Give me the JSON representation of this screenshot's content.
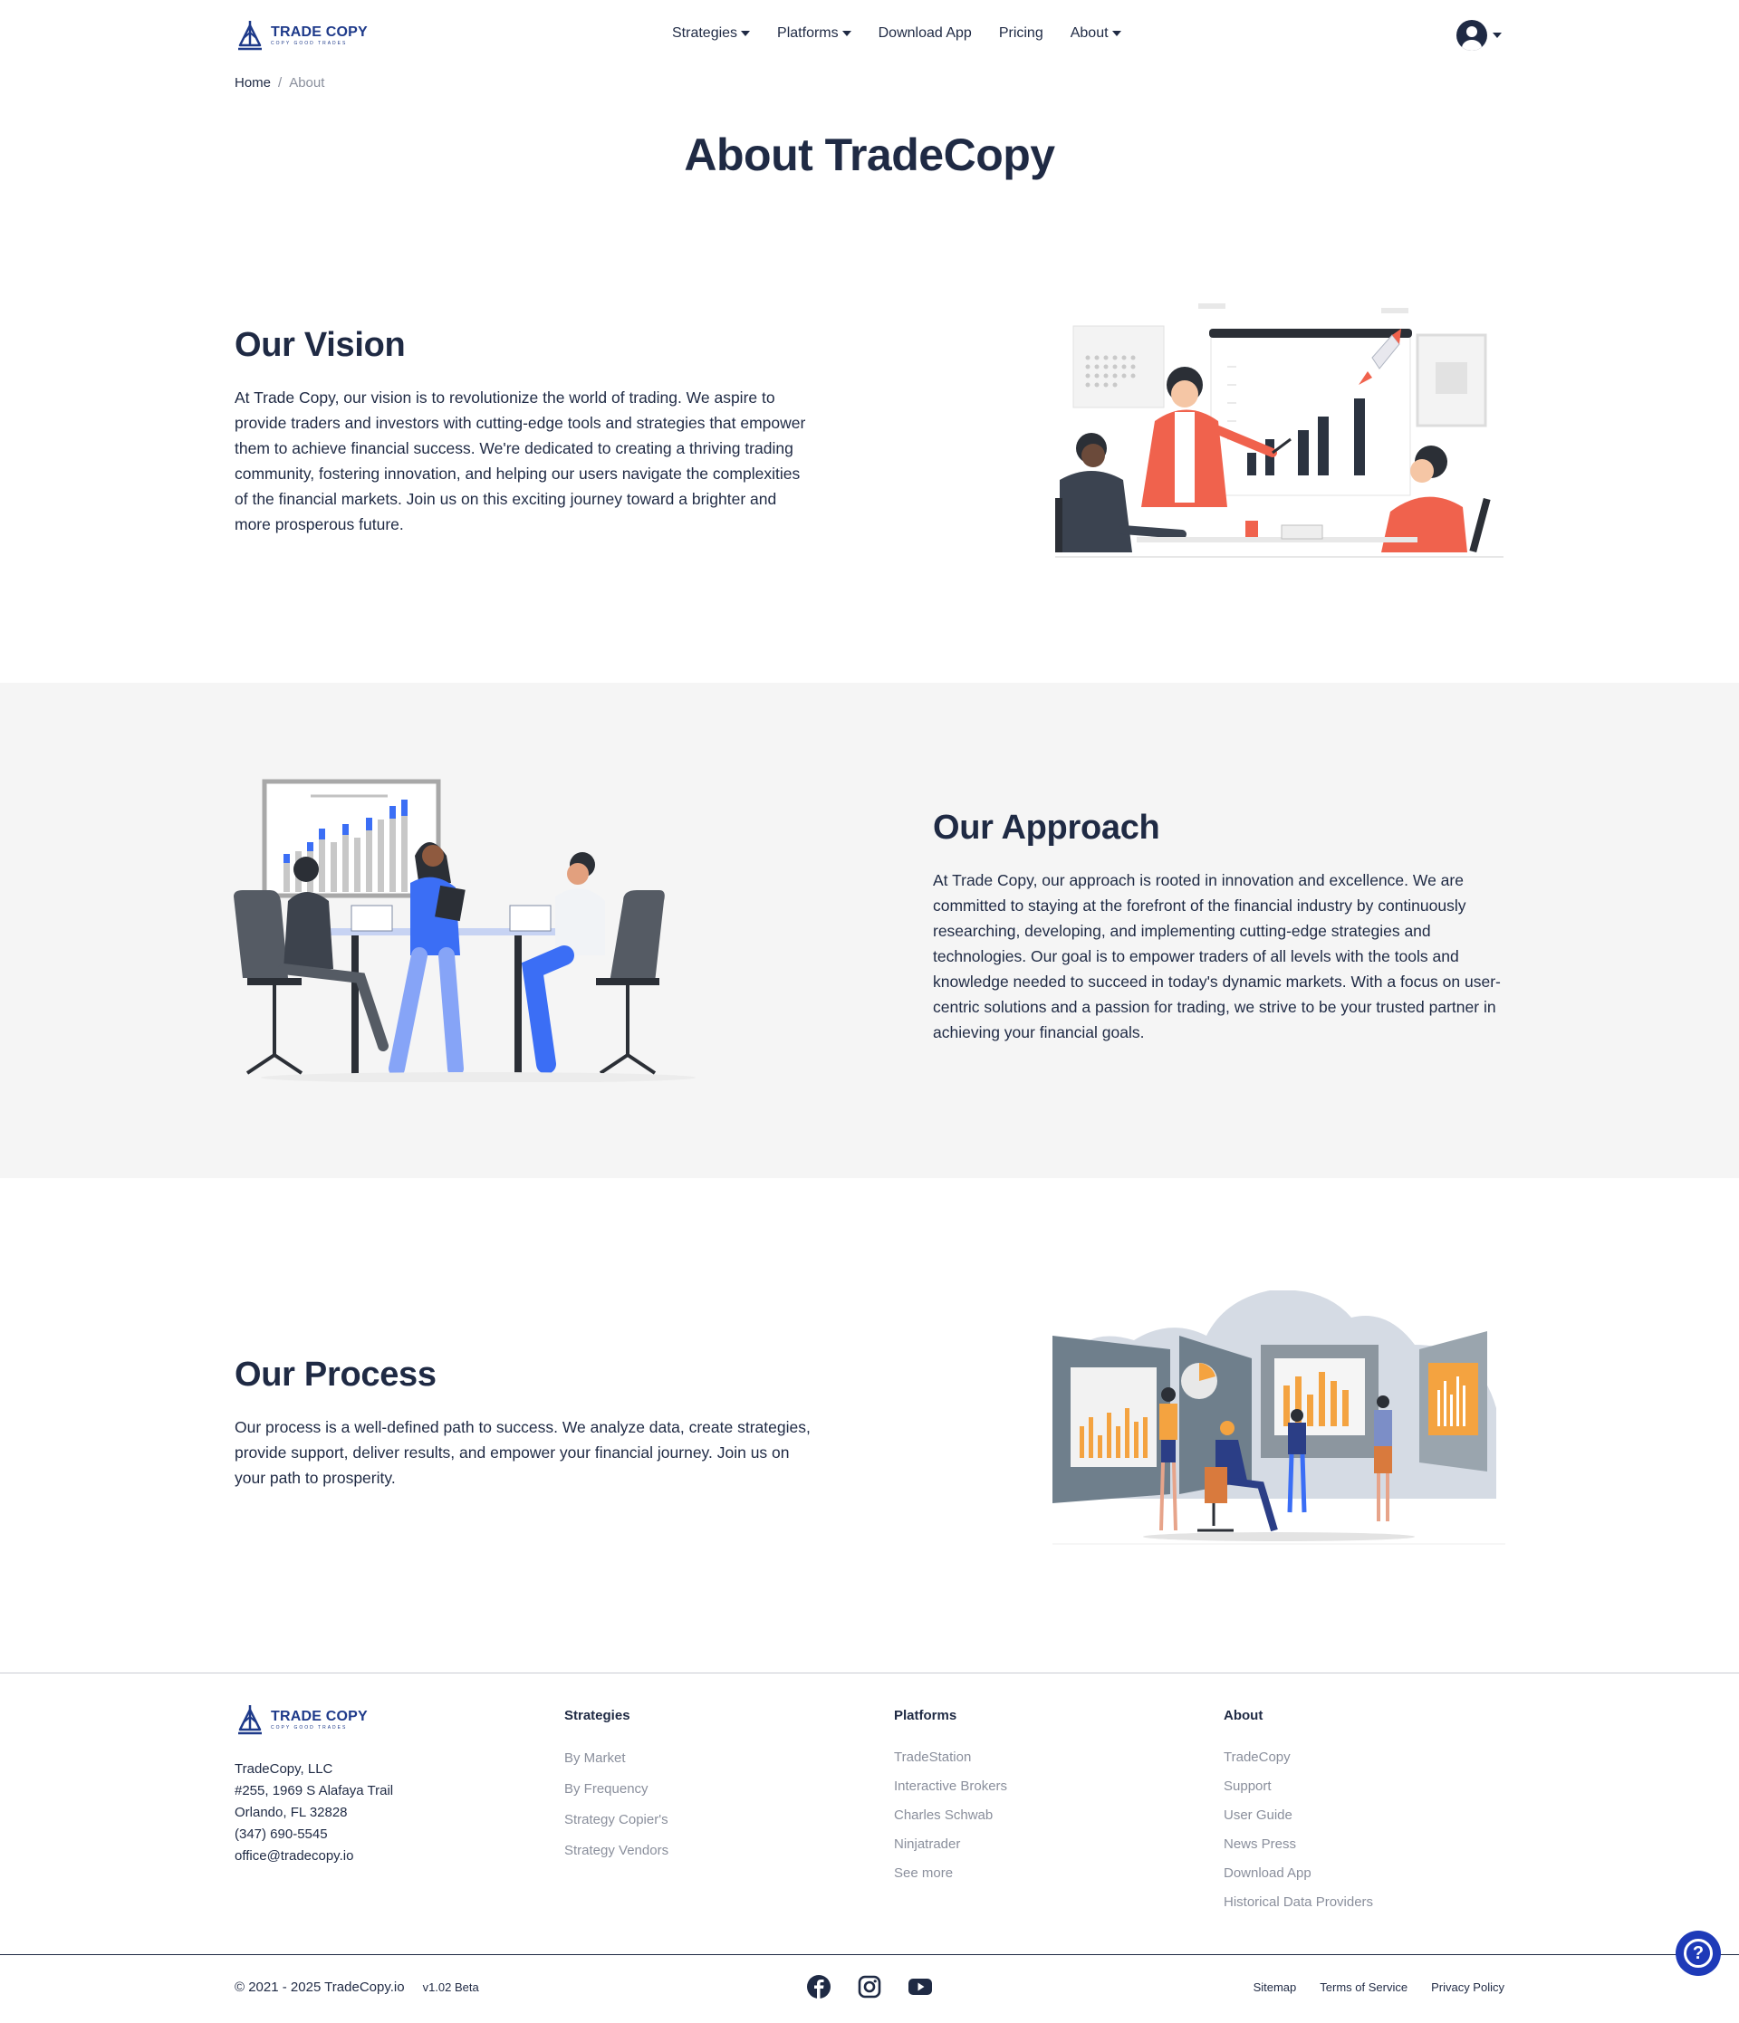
{
  "brand": {
    "name": "TRADE COPY",
    "tagline": "COPY GOOD TRADES"
  },
  "nav": {
    "items": [
      {
        "label": "Strategies",
        "has_dropdown": true
      },
      {
        "label": "Platforms",
        "has_dropdown": true
      },
      {
        "label": "Download App",
        "has_dropdown": false
      },
      {
        "label": "Pricing",
        "has_dropdown": false
      },
      {
        "label": "About",
        "has_dropdown": true
      }
    ],
    "user_icon": "user-circle-icon"
  },
  "breadcrumb": {
    "home": "Home",
    "separator": "/",
    "current": "About"
  },
  "page_title": "About TradeCopy",
  "sections": {
    "vision": {
      "title": "Our Vision",
      "text": "At Trade Copy, our vision is to revolutionize the world of trading. We aspire to provide traders and investors with cutting-edge tools and strategies that empower them to achieve financial success. We're dedicated to creating a thriving trading community, fostering innovation, and helping our users navigate the complexities of the financial markets. Join us on this exciting journey toward a brighter and more prosperous future."
    },
    "approach": {
      "title": "Our Approach",
      "text": "At Trade Copy, our approach is rooted in innovation and excellence. We are committed to staying at the forefront of the financial industry by continuously researching, developing, and implementing cutting-edge strategies and technologies. Our goal is to empower traders of all levels with the tools and knowledge needed to succeed in today's dynamic markets. With a focus on user-centric solutions and a passion for trading, we strive to be your trusted partner in achieving your financial goals."
    },
    "process": {
      "title": "Our Process",
      "text": "Our process is a well-defined path to success. We analyze data, create strategies, provide support, deliver results, and empower your financial journey. Join us on your path to prosperity."
    }
  },
  "footer": {
    "address": {
      "company": "TradeCopy, LLC",
      "street": "#255, 1969 S Alafaya Trail",
      "city": "Orlando, FL 32828",
      "phone": "(347) 690-5545",
      "email": "office@tradecopy.io"
    },
    "strategies": {
      "heading": "Strategies",
      "links": [
        "By Market",
        "By Frequency",
        "Strategy Copier's",
        "Strategy Vendors"
      ]
    },
    "platforms": {
      "heading": "Platforms",
      "links": [
        "TradeStation",
        "Interactive Brokers",
        "Charles Schwab",
        "Ninjatrader",
        "See more"
      ]
    },
    "about": {
      "heading": "About",
      "links": [
        "TradeCopy",
        "Support",
        "User Guide",
        "News Press",
        "Download App",
        "Historical Data Providers"
      ]
    },
    "copyright": "© 2021 - 2025 TradeCopy.io",
    "version": "v1.02 Beta",
    "socials": [
      "facebook-icon",
      "instagram-icon",
      "youtube-icon"
    ],
    "legal": [
      "Sitemap",
      "Terms of Service",
      "Privacy Policy"
    ]
  },
  "colors": {
    "primary": "#1f2a44",
    "brand_blue": "#1e3a8a",
    "help_blue": "#1e3ab8",
    "accent_red": "#f0624d",
    "accent_blue": "#3b6ef5",
    "accent_orange": "#f4a340",
    "muted": "#8a8f9c"
  }
}
